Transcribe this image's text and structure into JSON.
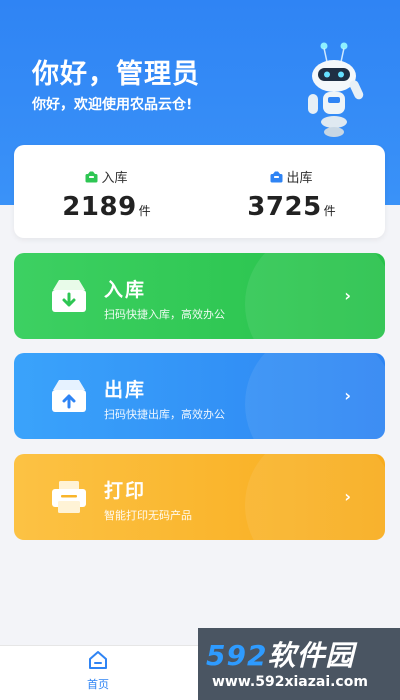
{
  "header": {
    "title": "你好，管理员",
    "subtitle": "你好，欢迎使用农品云仓!"
  },
  "stats": {
    "in": {
      "label": "入库",
      "value": "2189",
      "unit": "件"
    },
    "out": {
      "label": "出库",
      "value": "3725",
      "unit": "件"
    }
  },
  "actions": [
    {
      "title": "入库",
      "desc": "扫码快捷入库，高效办公",
      "color": "#2ec653"
    },
    {
      "title": "出库",
      "desc": "扫码快捷出库，高效办公",
      "color": "#3192f6"
    },
    {
      "title": "打印",
      "desc": "智能打印无码产品",
      "color": "#f9b52b"
    }
  ],
  "tabbar": {
    "home_label": "首页"
  },
  "watermark": {
    "brand_digits": "592",
    "brand_text": "软件园",
    "url": "www.592xiazai.com"
  }
}
